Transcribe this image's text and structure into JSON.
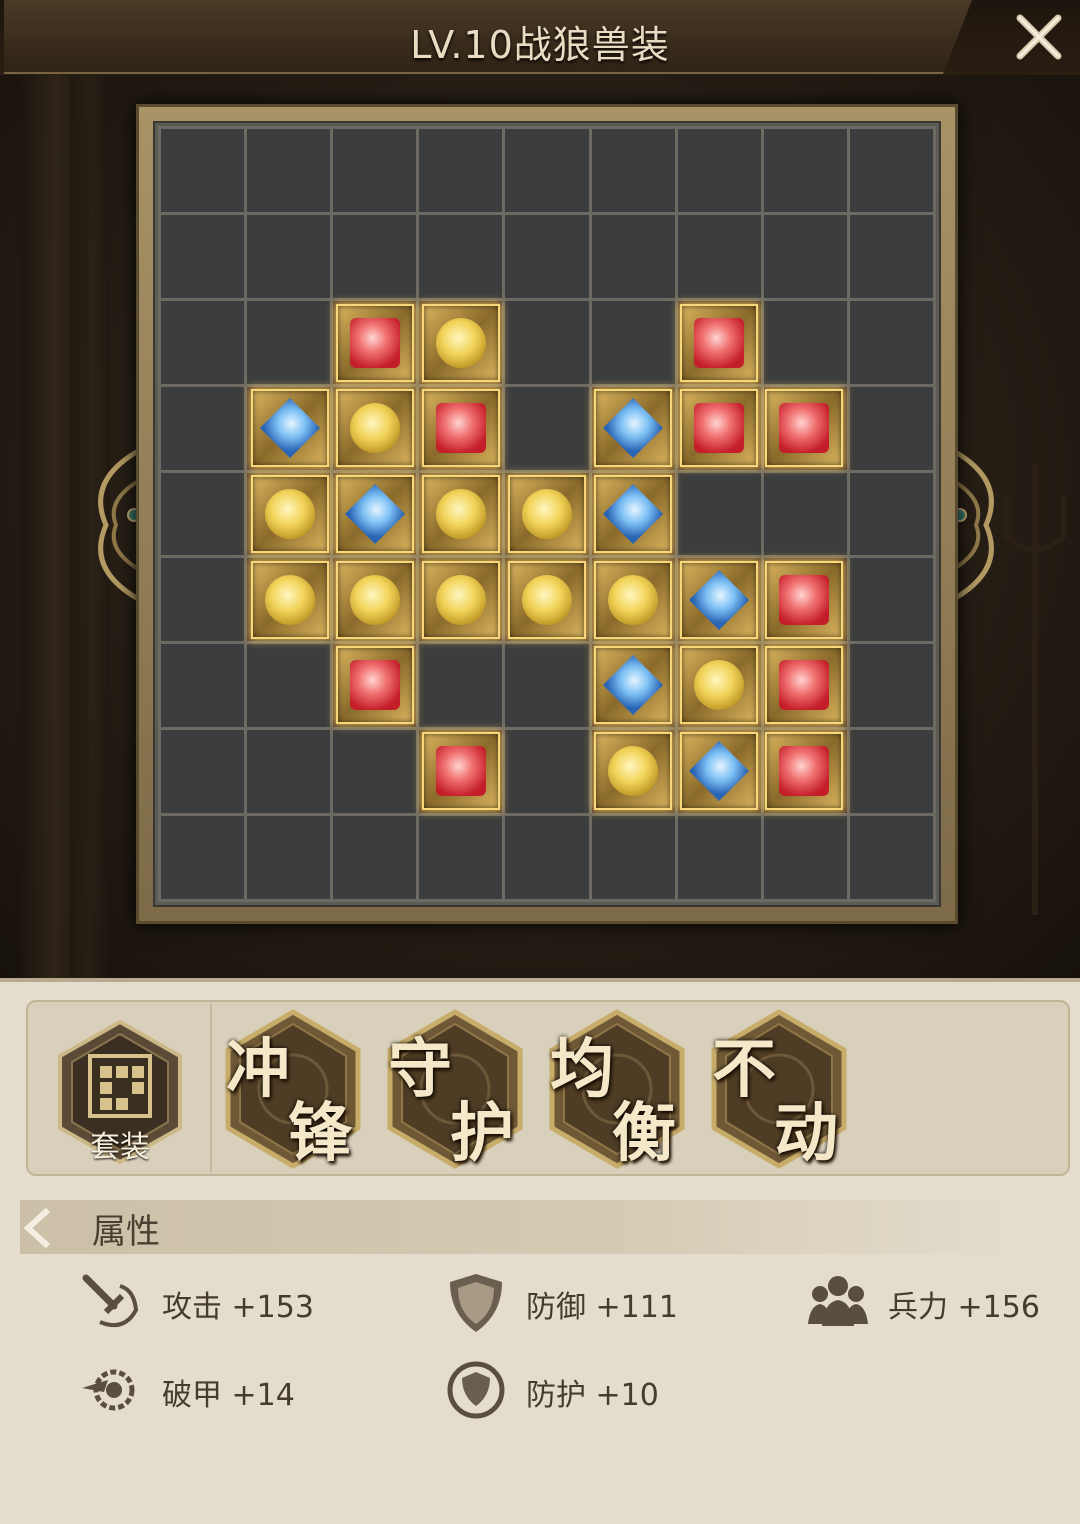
{
  "header": {
    "title": "LV.10战狼兽装",
    "close_icon": "close-icon"
  },
  "board": {
    "rows": 9,
    "cols": 9,
    "gems": [
      {
        "r": 2,
        "c": 2,
        "color": "red"
      },
      {
        "r": 2,
        "c": 3,
        "color": "yellow"
      },
      {
        "r": 2,
        "c": 6,
        "color": "red"
      },
      {
        "r": 3,
        "c": 1,
        "color": "blue"
      },
      {
        "r": 3,
        "c": 2,
        "color": "yellow"
      },
      {
        "r": 3,
        "c": 3,
        "color": "red"
      },
      {
        "r": 3,
        "c": 5,
        "color": "blue"
      },
      {
        "r": 3,
        "c": 6,
        "color": "red"
      },
      {
        "r": 3,
        "c": 7,
        "color": "red"
      },
      {
        "r": 4,
        "c": 1,
        "color": "yellow"
      },
      {
        "r": 4,
        "c": 2,
        "color": "blue"
      },
      {
        "r": 4,
        "c": 3,
        "color": "yellow"
      },
      {
        "r": 4,
        "c": 4,
        "color": "yellow"
      },
      {
        "r": 4,
        "c": 5,
        "color": "blue"
      },
      {
        "r": 5,
        "c": 1,
        "color": "yellow"
      },
      {
        "r": 5,
        "c": 2,
        "color": "yellow"
      },
      {
        "r": 5,
        "c": 3,
        "color": "yellow"
      },
      {
        "r": 5,
        "c": 4,
        "color": "yellow"
      },
      {
        "r": 5,
        "c": 5,
        "color": "yellow"
      },
      {
        "r": 5,
        "c": 6,
        "color": "blue"
      },
      {
        "r": 5,
        "c": 7,
        "color": "red"
      },
      {
        "r": 6,
        "c": 2,
        "color": "red"
      },
      {
        "r": 6,
        "c": 5,
        "color": "blue"
      },
      {
        "r": 6,
        "c": 6,
        "color": "yellow"
      },
      {
        "r": 6,
        "c": 7,
        "color": "red"
      },
      {
        "r": 7,
        "c": 3,
        "color": "red"
      },
      {
        "r": 7,
        "c": 5,
        "color": "yellow"
      },
      {
        "r": 7,
        "c": 6,
        "color": "blue"
      },
      {
        "r": 7,
        "c": 7,
        "color": "red"
      }
    ],
    "gem_colors": {
      "red": "#d8323c",
      "yellow": "#e8c24a",
      "blue": "#4a8ee0"
    }
  },
  "sets": {
    "current_label": "套装",
    "badges": [
      {
        "top": "冲",
        "bottom": "锋"
      },
      {
        "top": "守",
        "bottom": "护"
      },
      {
        "top": "均",
        "bottom": "衡"
      },
      {
        "top": "不",
        "bottom": "动"
      }
    ]
  },
  "attributes": {
    "title": "属性",
    "stats": [
      {
        "icon": "sword-icon",
        "text": "攻击 +153"
      },
      {
        "icon": "shield-icon",
        "text": "防御 +111"
      },
      {
        "icon": "troops-icon",
        "text": "兵力 +156"
      },
      {
        "icon": "armor-break-icon",
        "text": "破甲 +14"
      },
      {
        "icon": "protection-icon",
        "text": "防护 +10"
      }
    ]
  }
}
